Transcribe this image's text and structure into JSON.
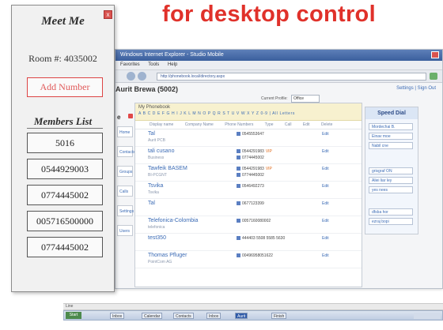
{
  "headline": "for desktop control",
  "browser": {
    "title": "Windows Internet Explorer - Studio Mobile",
    "menu": [
      "Favorites",
      "Tools",
      "Help"
    ],
    "url": "http://phonebook.local/directory.aspx",
    "page_title": "Aurit Brewa (5002)",
    "settings_link": "Settings | Sign Out",
    "current_profile_label": "Current Profile:",
    "current_profile_value": "Office (07744450...)",
    "left_label": "e",
    "left_tabs": [
      "Home",
      "Contacts",
      "Groups",
      "Calls",
      "Settings",
      "Users"
    ]
  },
  "phonebook": {
    "title": "My Phonebook",
    "letters": "A B C D E F G H I J K L M N O P Q R S T U V W X Y Z 0-9 | All Letters",
    "columns": [
      "Display name",
      "Company Name",
      "Phone Numbers",
      "Type",
      "Call",
      "Edit",
      "Delete"
    ],
    "rows": [
      {
        "name": "Tal",
        "sub": "Aurit PCB",
        "phone": "0545553647",
        "phone2": "",
        "tag": "",
        "edit": "Edit"
      },
      {
        "name": "tali cusano",
        "sub": "Business",
        "phone": "0544291983",
        "phone2": "0774445002",
        "tag": "VIP",
        "edit": "Edit"
      },
      {
        "name": "Tawfeik BASEM",
        "sub": "BI-PCGNT",
        "phone": "0544291983",
        "phone2": "0774445002",
        "tag": "VIP",
        "edit": "Edit"
      },
      {
        "name": "Tsvika",
        "sub": "Tsvika",
        "phone": "0546492273",
        "phone2": "",
        "tag": "",
        "edit": "Edit"
      },
      {
        "name": "Tal",
        "sub": "",
        "phone": "0677123399",
        "phone2": "",
        "tag": "",
        "edit": "Edit"
      },
      {
        "name": "Telefonica-Colombia",
        "sub": "telefonica",
        "phone": "0057160080002",
        "phone2": "",
        "tag": "",
        "edit": "Edit"
      },
      {
        "name": "test350",
        "sub": "",
        "phone": "444403 5508 5585 5630",
        "phone2": "",
        "tag": "",
        "edit": "Edit"
      },
      {
        "name": "Thomas Pfluger",
        "sub": "PointCom AG",
        "phone": "00496958051622",
        "phone2": "",
        "tag": "",
        "edit": "Edit"
      }
    ]
  },
  "speed_dial": {
    "title": "Speed Dial",
    "items": [
      "Mordechai B.",
      "Einav moe",
      "Nabil cne",
      "grisgraf ON",
      "Aliei liar ley",
      "yes nees",
      "dfsba hor",
      "ezraj bopi"
    ]
  },
  "meet_me": {
    "title": "Meet Me",
    "close": "x",
    "room": "Room #: 4035002",
    "add_button": "Add Number",
    "members_title": "Members List",
    "members": [
      "5016",
      "0544929003",
      "0774445002",
      "005716500000",
      "0774445002"
    ]
  },
  "taskbar": {
    "ruler": "Line",
    "start": "Start",
    "tasks": [
      "Inbox",
      "Calendar",
      "Contacts",
      "Inbox",
      "Aurit",
      "Finish"
    ]
  },
  "colors": {
    "headline": "#e0312a",
    "add_button_border": "#dd4444",
    "link": "#3b6bb5"
  }
}
